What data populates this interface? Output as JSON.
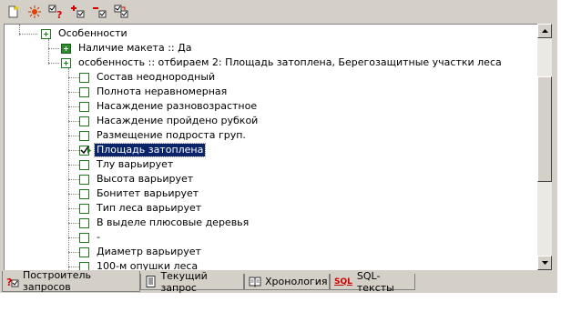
{
  "toolbar": {
    "icons": [
      "new-query-icon",
      "clear-icon",
      "check-help-icon",
      "add-condition-icon",
      "remove-condition-icon",
      "copy-checked-icon"
    ]
  },
  "tree": {
    "root_label": "Особенности",
    "nodes": [
      {
        "label": "Наличие макета :: Да"
      },
      {
        "label": "особенность :: отбираем 2: Площадь затоплена, Берегозащитные участки леса"
      }
    ],
    "items": [
      {
        "label": "Состав неоднородный",
        "checked": false
      },
      {
        "label": "Полнота неравномерная",
        "checked": false
      },
      {
        "label": "Насаждение разновозрастное",
        "checked": false
      },
      {
        "label": "Насаждение пройдено рубкой",
        "checked": false
      },
      {
        "label": "Размещение подроста груп.",
        "checked": false
      },
      {
        "label": "Площадь затоплена",
        "checked": true
      },
      {
        "label": "Тлу варьирует",
        "checked": false
      },
      {
        "label": "Высота варьирует",
        "checked": false
      },
      {
        "label": "Бонитет варьирует",
        "checked": false
      },
      {
        "label": "Тип леса варьирует",
        "checked": false
      },
      {
        "label": "В выделе плюсовые деревья",
        "checked": false
      },
      {
        "label": "-",
        "checked": false
      },
      {
        "label": "Диаметр варьирует",
        "checked": false
      },
      {
        "label": "100-м опушки леса",
        "checked": false
      }
    ]
  },
  "tabs": [
    {
      "label": "Построитель запросов",
      "active": true
    },
    {
      "label": "Текущий запрос",
      "active": false
    },
    {
      "label": "Хронология",
      "active": false
    },
    {
      "label": "SQL-тексты",
      "active": false,
      "icon_text": "SQL"
    }
  ],
  "colors": {
    "tree_green": "#1f7a1f",
    "selection": "#0a246a",
    "sql_red": "#cc0000"
  }
}
